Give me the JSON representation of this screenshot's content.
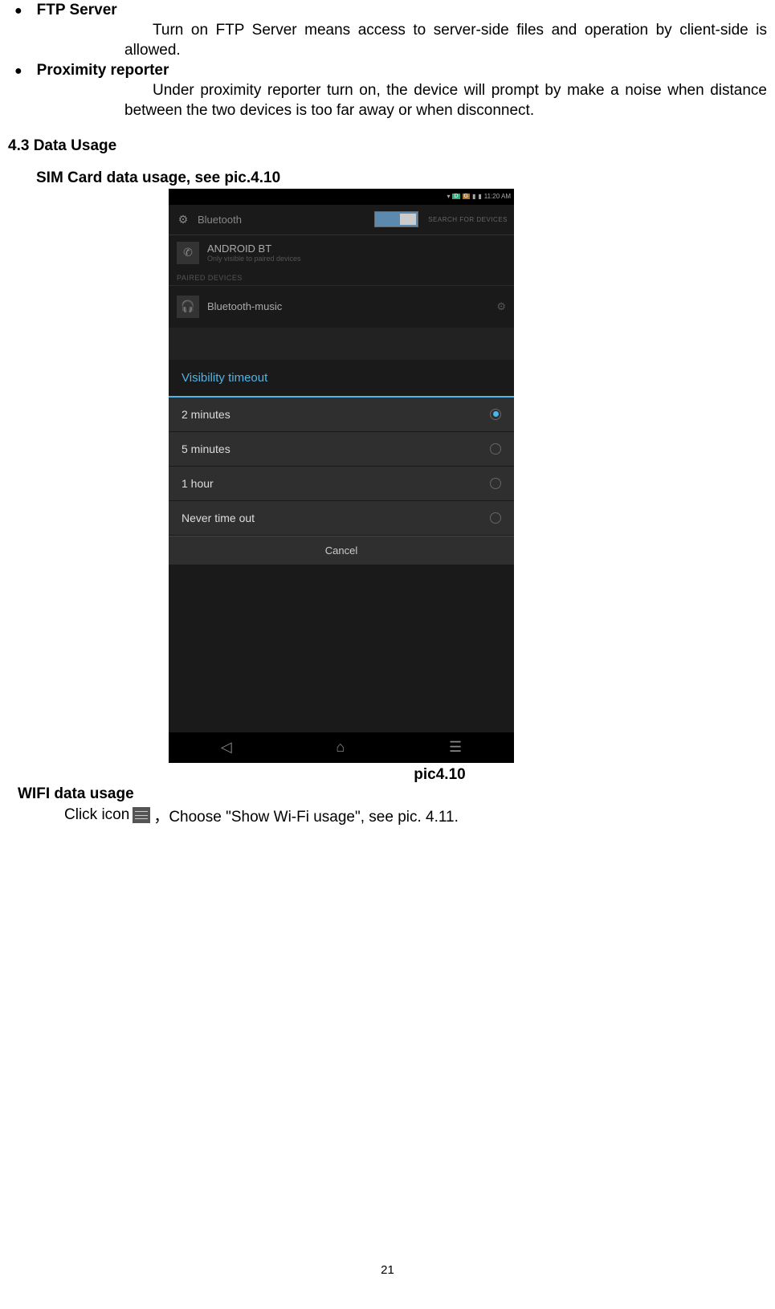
{
  "bullets": {
    "ftp_title": "FTP Server",
    "ftp_body": "Turn on FTP Server means access to server-side files and operation by client-side is allowed.",
    "prox_title": "Proximity reporter",
    "prox_body": "Under proximity reporter turn on, the device will prompt by make a noise when distance between the two devices is too far away or when disconnect."
  },
  "section": {
    "data_usage": "4.3 Data Usage",
    "sim_heading": "SIM Card data usage, see pic.4.10"
  },
  "screenshot": {
    "status_time": "11:20 AM",
    "status_d": "D",
    "status_g": "G",
    "bt_label": "Bluetooth",
    "search": "SEARCH FOR DEVICES",
    "android_bt": "ANDROID BT",
    "android_sub": "Only visible to paired devices",
    "paired_label": "PAIRED DEVICES",
    "bt_music": "Bluetooth-music",
    "dialog_title": "Visibility timeout",
    "opt1": "2 minutes",
    "opt2": "5 minutes",
    "opt3": "1 hour",
    "opt4": "Never time out",
    "cancel": "Cancel"
  },
  "caption": "pic4.10",
  "wifi": {
    "heading": "WIFI data usage",
    "click_pre": "Click icon ",
    "click_post": "，Choose \"Show Wi-Fi usage\", see pic. 4.11."
  },
  "page_number": "21"
}
